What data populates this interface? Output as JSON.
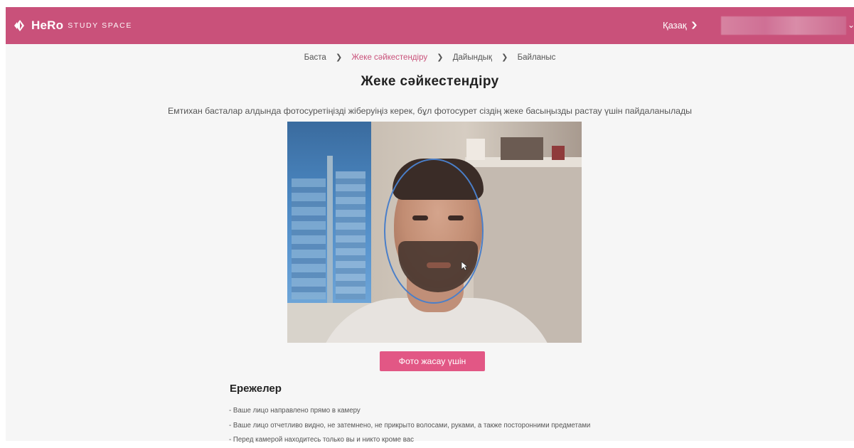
{
  "header": {
    "logo_brand": "HeRo",
    "logo_sub": "STUDY SPACE",
    "language": "Қазақ",
    "brand_color": "#c9517a"
  },
  "breadcrumb": {
    "items": [
      {
        "label": "Баста",
        "active": false
      },
      {
        "label": "Жеке сәйкестендіру",
        "active": true
      },
      {
        "label": "Дайындық",
        "active": false
      },
      {
        "label": "Байланыс",
        "active": false
      }
    ],
    "active_color": "#c9517a"
  },
  "main": {
    "title": "Жеке сәйкестендіру",
    "subtitle": "Емтихан басталар алдында фотосуретіңізді жіберуіңіз керек, бұл фотосурет сіздің жеке басыңызды растау үшін пайдаланылады",
    "photo_button": "Фото жасау үшін",
    "button_color": "#e25785",
    "face_guide_color": "#4a7fc9"
  },
  "rules": {
    "title": "Ережелер",
    "items": [
      "- Ваше лицо направлено прямо в камеру",
      "- Ваше лицо отчетливо видно, не затемнено, не прикрыто волосами, руками, а также посторонними предметами",
      "- Перед камерой находитесь только вы и никто кроме вас"
    ]
  },
  "icons": {
    "logo": "hero-logo-icon",
    "language_dropdown": "chevron-down-icon",
    "user_dropdown": "chevron-down-icon",
    "breadcrumb_separator": "chevron-right-icon"
  }
}
